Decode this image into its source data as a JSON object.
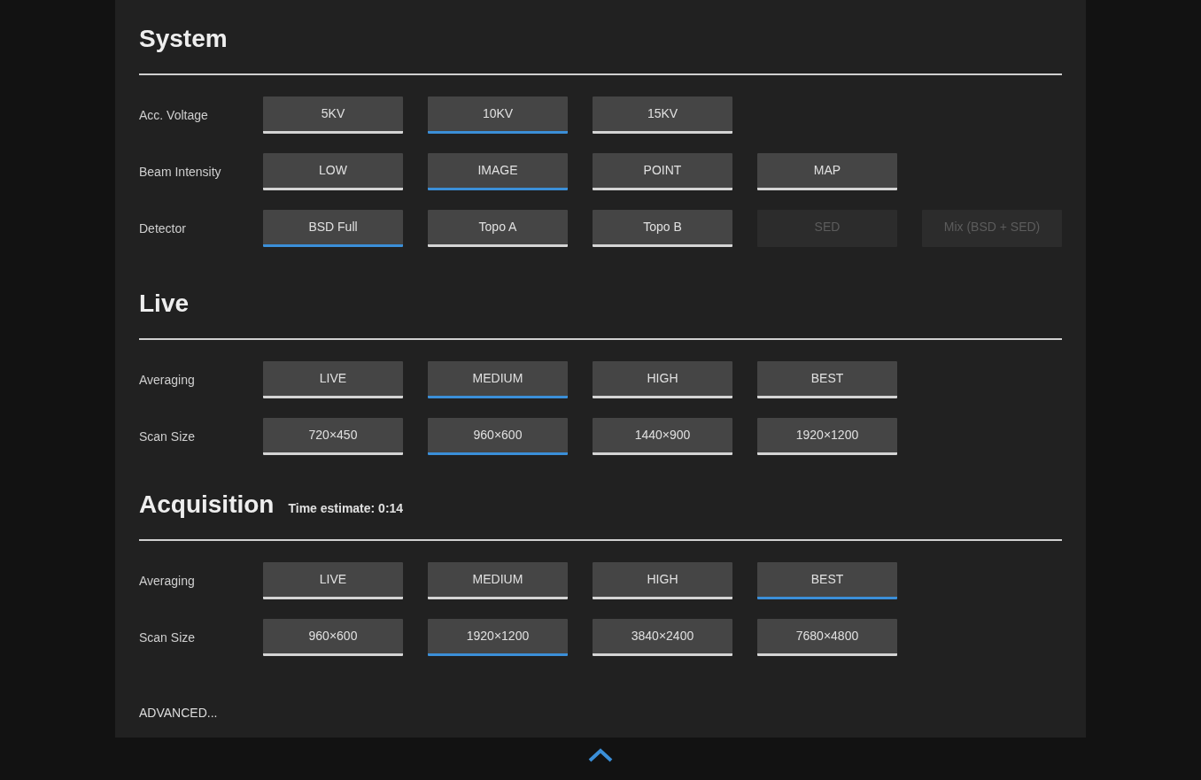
{
  "sections": [
    {
      "title": "System",
      "rows": [
        {
          "label": "Acc. Voltage",
          "options": [
            {
              "label": "5KV",
              "selected": false,
              "disabled": false
            },
            {
              "label": "10KV",
              "selected": true,
              "disabled": false
            },
            {
              "label": "15KV",
              "selected": false,
              "disabled": false
            }
          ]
        },
        {
          "label": "Beam Intensity",
          "options": [
            {
              "label": "LOW",
              "selected": false,
              "disabled": false
            },
            {
              "label": "IMAGE",
              "selected": true,
              "disabled": false
            },
            {
              "label": "POINT",
              "selected": false,
              "disabled": false
            },
            {
              "label": "MAP",
              "selected": false,
              "disabled": false
            }
          ]
        },
        {
          "label": "Detector",
          "options": [
            {
              "label": "BSD Full",
              "selected": true,
              "disabled": false
            },
            {
              "label": "Topo A",
              "selected": false,
              "disabled": false
            },
            {
              "label": "Topo B",
              "selected": false,
              "disabled": false
            },
            {
              "label": "SED",
              "selected": false,
              "disabled": true
            },
            {
              "label": "Mix (BSD + SED)",
              "selected": false,
              "disabled": true
            }
          ]
        }
      ]
    },
    {
      "title": "Live",
      "rows": [
        {
          "label": "Averaging",
          "options": [
            {
              "label": "LIVE",
              "selected": false,
              "disabled": false
            },
            {
              "label": "MEDIUM",
              "selected": true,
              "disabled": false
            },
            {
              "label": "HIGH",
              "selected": false,
              "disabled": false
            },
            {
              "label": "BEST",
              "selected": false,
              "disabled": false
            }
          ]
        },
        {
          "label": "Scan Size",
          "options": [
            {
              "label": "720×450",
              "selected": false,
              "disabled": false
            },
            {
              "label": "960×600",
              "selected": true,
              "disabled": false
            },
            {
              "label": "1440×900",
              "selected": false,
              "disabled": false
            },
            {
              "label": "1920×1200",
              "selected": false,
              "disabled": false
            }
          ]
        }
      ]
    },
    {
      "title": "Acquisition",
      "note": "Time estimate: 0:14",
      "rows": [
        {
          "label": "Averaging",
          "options": [
            {
              "label": "LIVE",
              "selected": false,
              "disabled": false
            },
            {
              "label": "MEDIUM",
              "selected": false,
              "disabled": false
            },
            {
              "label": "HIGH",
              "selected": false,
              "disabled": false
            },
            {
              "label": "BEST",
              "selected": true,
              "disabled": false
            }
          ]
        },
        {
          "label": "Scan Size",
          "options": [
            {
              "label": "960×600",
              "selected": false,
              "disabled": false
            },
            {
              "label": "1920×1200",
              "selected": true,
              "disabled": false
            },
            {
              "label": "3840×2400",
              "selected": false,
              "disabled": false
            },
            {
              "label": "7680×4800",
              "selected": false,
              "disabled": false
            }
          ]
        }
      ]
    }
  ],
  "advanced_link": "ADVANCED..."
}
